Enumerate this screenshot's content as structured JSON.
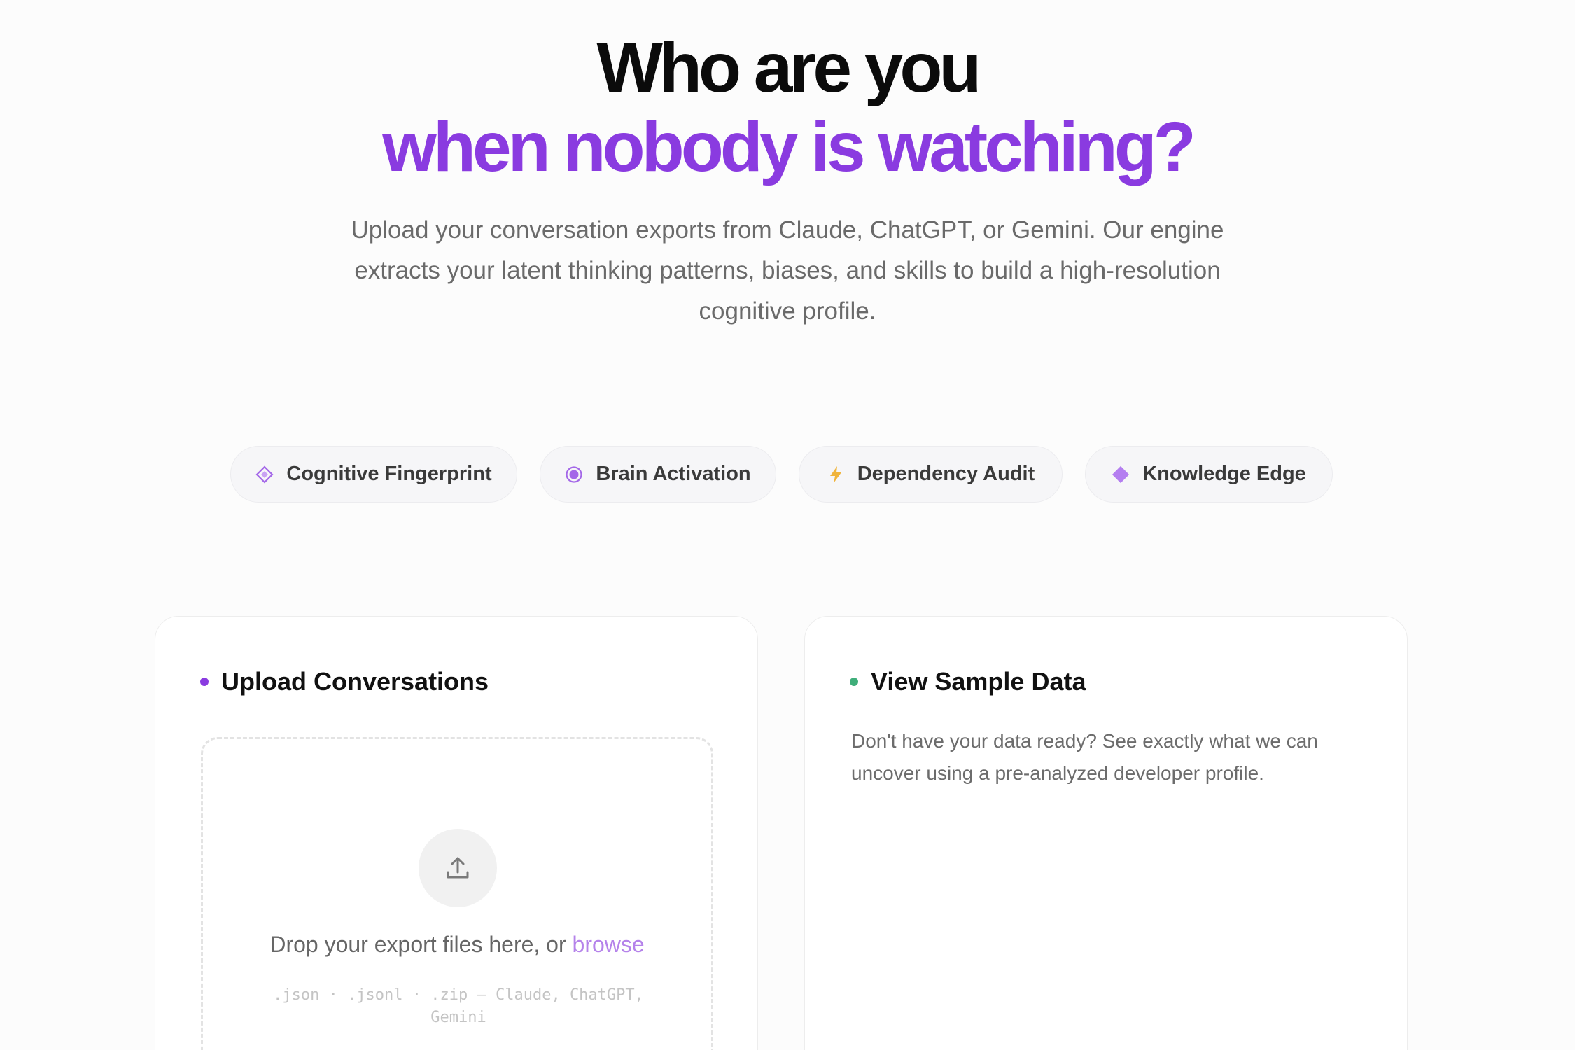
{
  "hero": {
    "title_line1": "Who are you",
    "title_line2": "when nobody is watching?",
    "subtitle": "Upload your conversation exports from Claude, ChatGPT, or Gemini. Our engine extracts your latent thinking patterns, biases, and skills to build a high-resolution cognitive profile."
  },
  "features": [
    {
      "label": "Cognitive Fingerprint",
      "icon": "diamond-outline-icon",
      "color": "#a468e8"
    },
    {
      "label": "Brain Activation",
      "icon": "target-circle-icon",
      "color": "#a468e8"
    },
    {
      "label": "Dependency Audit",
      "icon": "lightning-icon",
      "color": "#f0b43c"
    },
    {
      "label": "Knowledge Edge",
      "icon": "diamond-solid-icon",
      "color": "#b47ef0"
    }
  ],
  "upload_card": {
    "title": "Upload Conversations",
    "dropzone": {
      "icon": "upload-arrow-icon",
      "text_prefix": "Drop your export files here, or ",
      "browse_label": "browse",
      "formats": ".json · .jsonl · .zip — Claude, ChatGPT, Gemini"
    }
  },
  "sample_card": {
    "title": "View Sample Data",
    "description": "Don't have your data ready? See exactly what we can uncover using a pre-analyzed developer profile."
  },
  "colors": {
    "accent_purple": "#8a3be0",
    "accent_green": "#3fae7a",
    "browse_link": "#b583ea"
  }
}
